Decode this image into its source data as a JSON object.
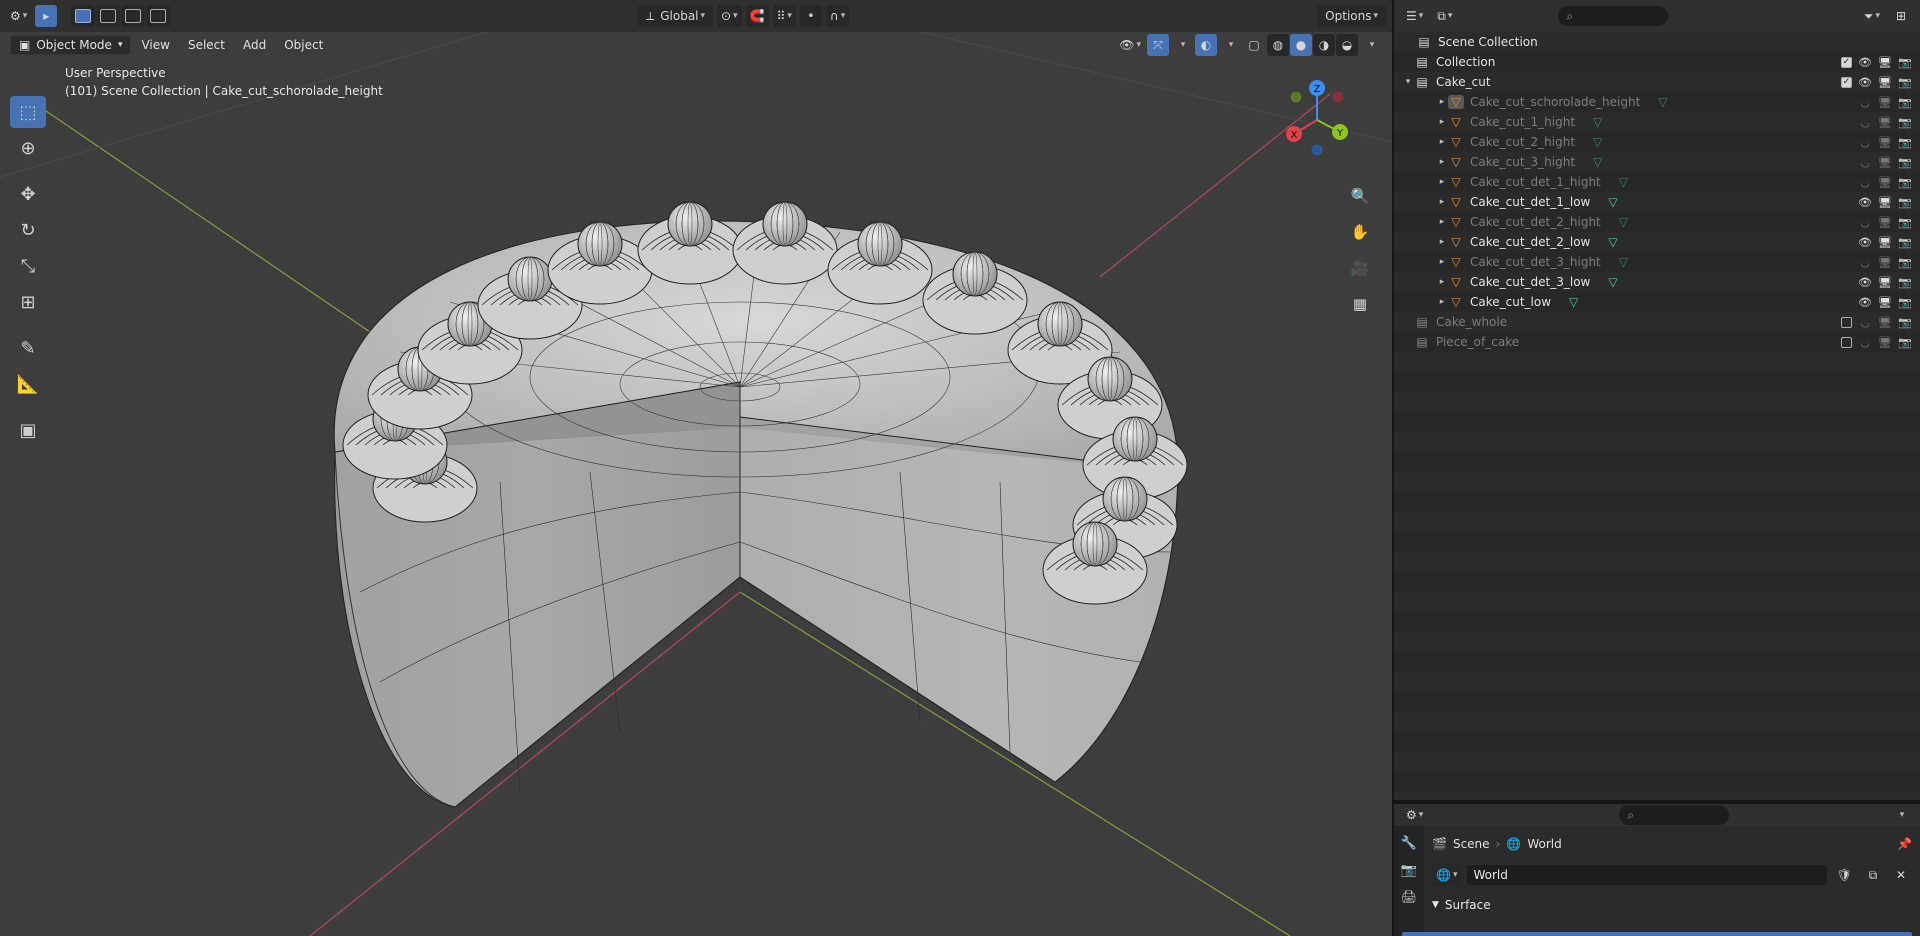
{
  "header": {
    "editor_icon": "editor-type-icon",
    "transform_orientation": "Global",
    "options_label": "Options"
  },
  "menubar": {
    "mode": "Object Mode",
    "items": [
      "View",
      "Select",
      "Add",
      "Object"
    ]
  },
  "viewport": {
    "perspective": "User Perspective",
    "context": "(101) Scene Collection | Cake_cut_schorolade_height",
    "gizmo": {
      "x": "X",
      "y": "Y",
      "z": "Z"
    }
  },
  "outliner": {
    "search_placeholder": "",
    "root": "Scene Collection",
    "rows": [
      {
        "label": "Collection",
        "type": "collection",
        "indent": 1,
        "expanded": false,
        "dim": false,
        "checkbox": true
      },
      {
        "label": "Cake_cut",
        "type": "collection",
        "indent": 1,
        "expanded": true,
        "dim": false,
        "checkbox": true
      },
      {
        "label": "Cake_cut_schorolade_height",
        "type": "mesh",
        "indent": 2,
        "dim": true,
        "selected_icon": true
      },
      {
        "label": "Cake_cut_1_hight",
        "type": "mesh",
        "indent": 2,
        "dim": true
      },
      {
        "label": "Cake_cut_2_hight",
        "type": "mesh",
        "indent": 2,
        "dim": true
      },
      {
        "label": "Cake_cut_3_hight",
        "type": "mesh",
        "indent": 2,
        "dim": true
      },
      {
        "label": "Cake_cut_det_1_hight",
        "type": "mesh",
        "indent": 2,
        "dim": true
      },
      {
        "label": "Cake_cut_det_1_low",
        "type": "mesh",
        "indent": 2,
        "dim": false
      },
      {
        "label": "Cake_cut_det_2_hight",
        "type": "mesh",
        "indent": 2,
        "dim": true
      },
      {
        "label": "Cake_cut_det_2_low",
        "type": "mesh",
        "indent": 2,
        "dim": false
      },
      {
        "label": "Cake_cut_det_3_hight",
        "type": "mesh",
        "indent": 2,
        "dim": true
      },
      {
        "label": "Cake_cut_det_3_low",
        "type": "mesh",
        "indent": 2,
        "dim": false
      },
      {
        "label": "Cake_cut_low",
        "type": "mesh",
        "indent": 2,
        "dim": false
      },
      {
        "label": "Cake_whole",
        "type": "collection",
        "indent": 1,
        "dim": true,
        "checkbox": false
      },
      {
        "label": "Piece_of_cake",
        "type": "collection",
        "indent": 1,
        "dim": true,
        "checkbox": false
      }
    ]
  },
  "properties": {
    "crumb_scene": "Scene",
    "crumb_world": "World",
    "world_name": "World",
    "panel": "Surface"
  },
  "colors": {
    "accent": "#4772b3",
    "axis_x": "#e2404d",
    "axis_y": "#8bc320",
    "axis_z": "#3b8ff0",
    "mesh_icon": "#50c8a0",
    "object_icon": "#e08a3a"
  }
}
